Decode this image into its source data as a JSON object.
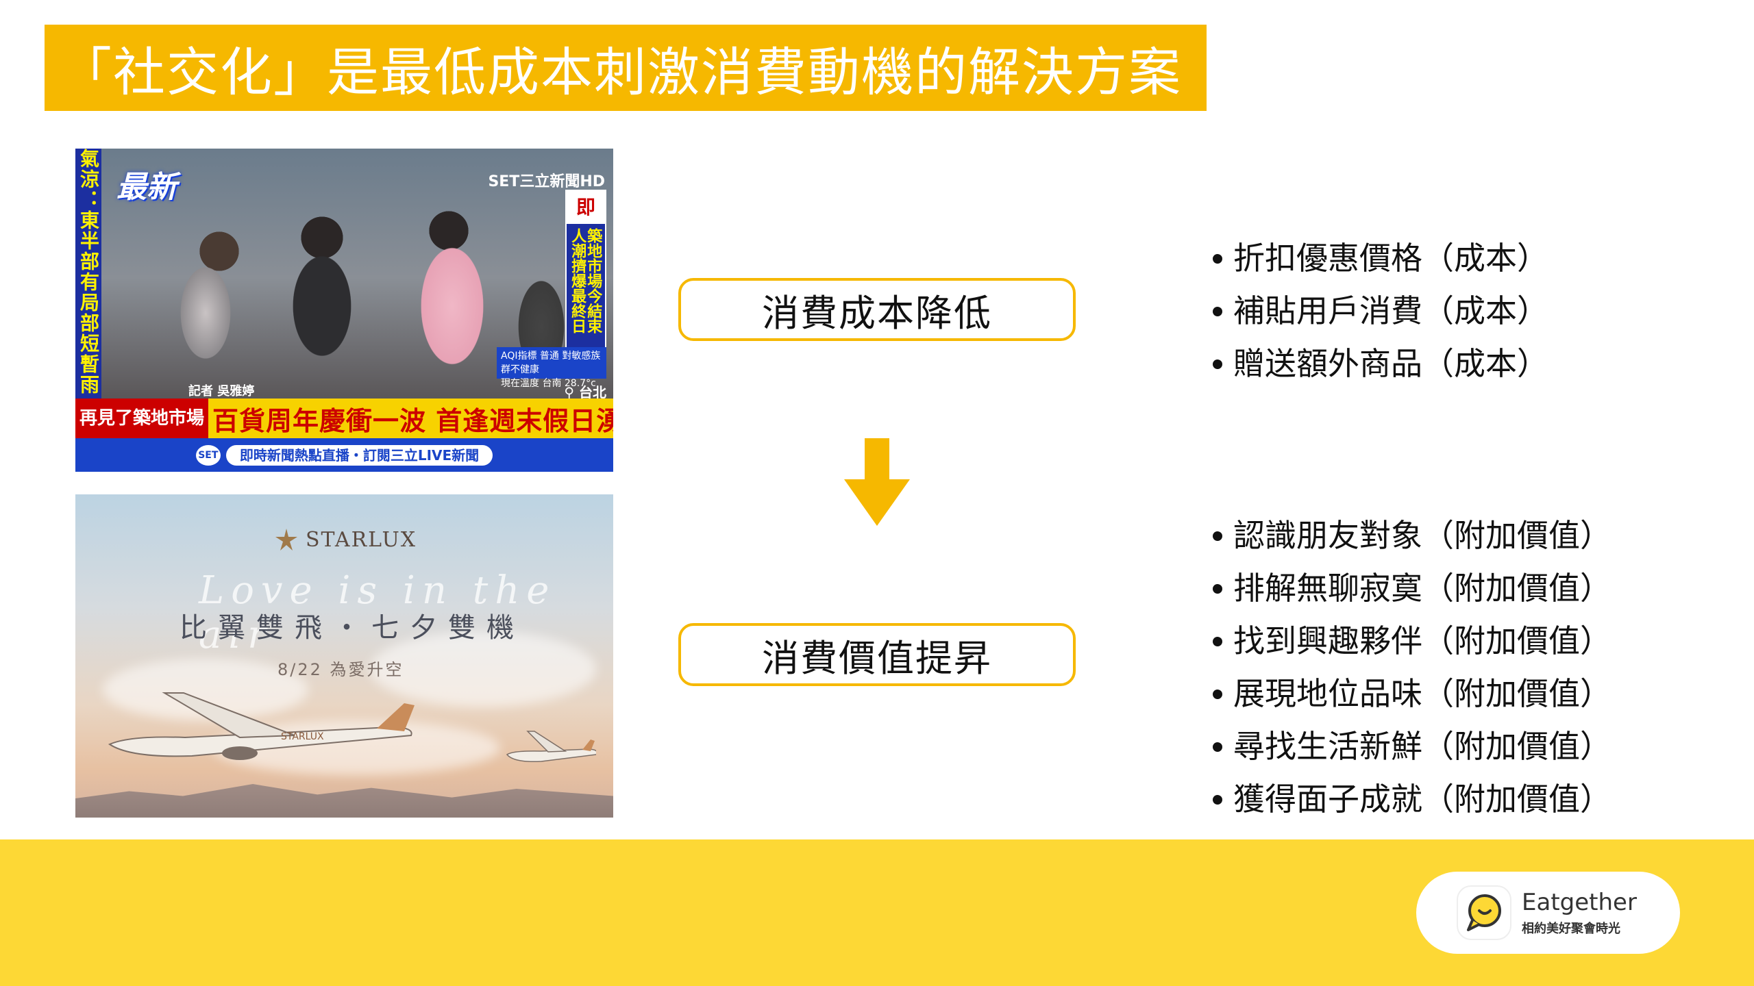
{
  "title": "「社交化」是最低成本刺激消費動機的解決方案",
  "news_image": {
    "left_ticker": "氣涼：東半部有局部短暫雨",
    "latest_badge": "最新",
    "channel": "SET三立新聞HD",
    "right_tag": "即",
    "right_text": "築地市場今結束 人潮擠爆最終日",
    "aqi_line1": "AQI指標 普通 對敏感族群不健康",
    "aqi_line2": "現在溫度 台南 28.7°c",
    "reporter": "記者 吳雅婷",
    "location": "台北",
    "headline_sub": "再見了築地市場",
    "headline_main": "百貨周年慶衝一波 首逢週末假日湧人潮",
    "ticker_logo": "SET",
    "ticker_text": "即時新聞熱點直播・訂閱三立LIVE新聞"
  },
  "starlux_image": {
    "brand": "STARLUX",
    "script": "Love is in the air",
    "tagline": "比翼雙飛・七夕雙機",
    "date": "8/22 為愛升空",
    "plane_livery": "STARLUX"
  },
  "boxes": {
    "cost": "消費成本降低",
    "value": "消費價值提昇"
  },
  "cost_items": [
    "折扣優惠價格（成本）",
    "補貼用戶消費（成本）",
    "贈送額外商品（成本）"
  ],
  "value_items": [
    "認識朋友對象（附加價值）",
    "排解無聊寂寞（附加價值）",
    "找到興趣夥伴（附加價值）",
    "展現地位品味（附加價值）",
    "尋找生活新鮮（附加價值）",
    "獲得面子成就（附加價值）"
  ],
  "brand_badge": {
    "name": "Eatgether",
    "subtitle": "相約美好聚會時光",
    "icon": "chat-bubble-icon"
  },
  "colors": {
    "accent": "#f6b800",
    "footer": "#fdd835"
  }
}
